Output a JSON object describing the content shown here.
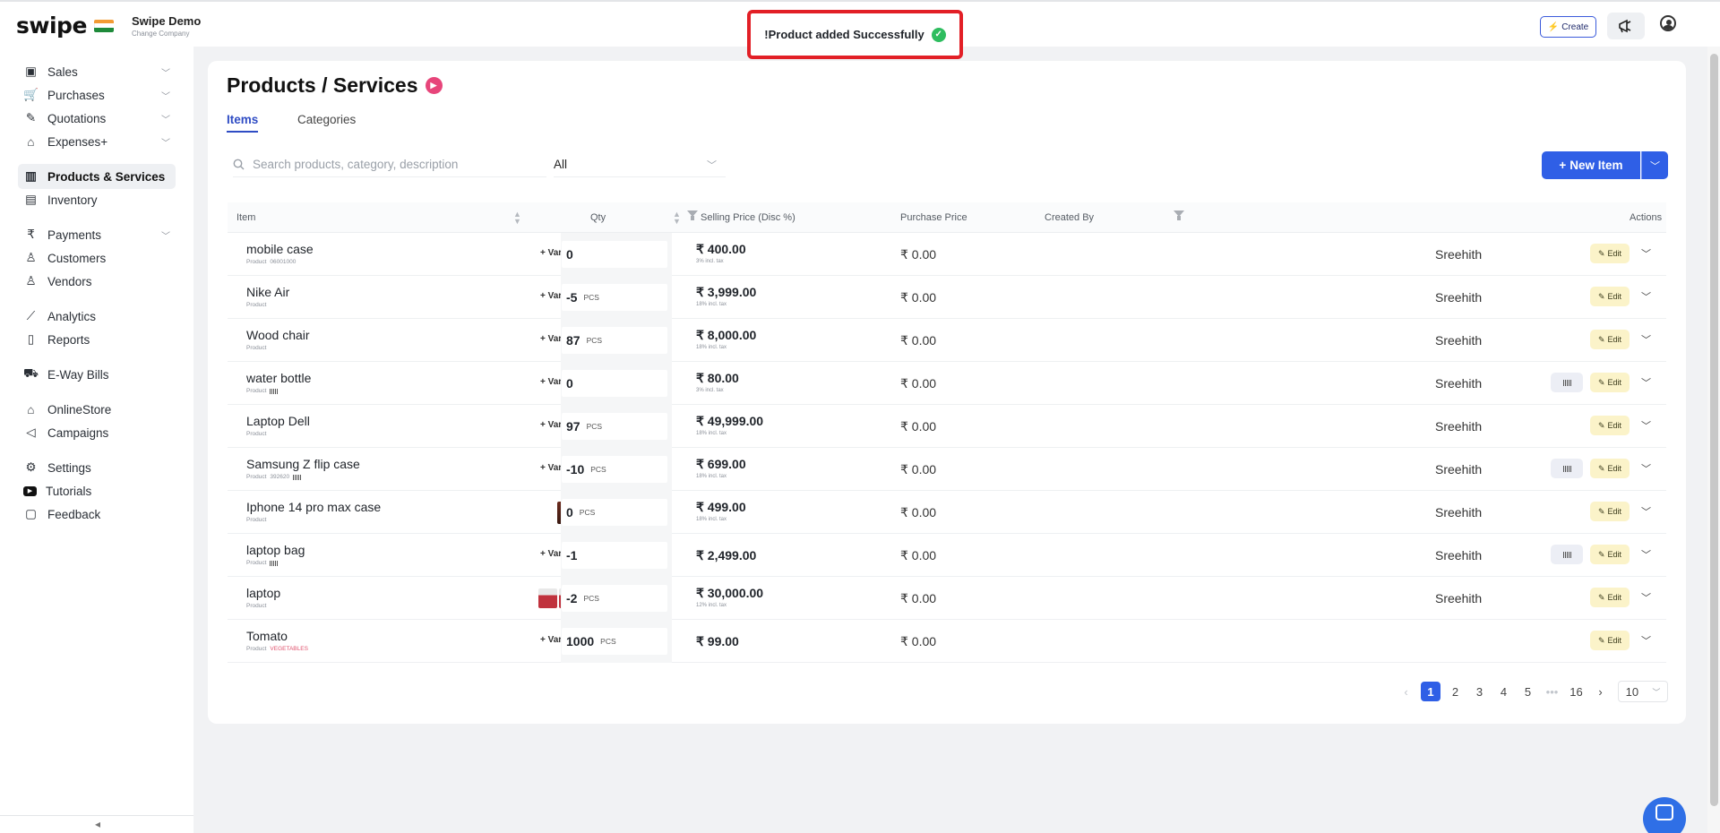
{
  "app": {
    "logo_text": "swipe",
    "company_name": "Swipe Demo",
    "company_sub": "Change Company",
    "create_label": "Create",
    "accent_color": "#2f5fe6"
  },
  "toast": {
    "message": "!Product added Successfully",
    "icon": "check-circle-icon"
  },
  "sidebar": {
    "items": [
      {
        "label": "Sales",
        "icon": "receipt-icon",
        "has_chevron": true
      },
      {
        "label": "Purchases",
        "icon": "cart-icon",
        "has_chevron": true
      },
      {
        "label": "Quotations",
        "icon": "pen-icon",
        "has_chevron": true
      },
      {
        "label": "Expenses+",
        "icon": "tag-icon",
        "has_chevron": true
      },
      {
        "label": "Products & Services",
        "icon": "barcode-icon",
        "has_chevron": false,
        "active": true
      },
      {
        "label": "Inventory",
        "icon": "warehouse-icon",
        "has_chevron": false
      },
      {
        "label": "Payments",
        "icon": "rupee-icon",
        "has_chevron": true
      },
      {
        "label": "Customers",
        "icon": "user-icon",
        "has_chevron": false
      },
      {
        "label": "Vendors",
        "icon": "users-icon",
        "has_chevron": false
      },
      {
        "label": "Analytics",
        "icon": "chart-icon",
        "has_chevron": false
      },
      {
        "label": "Reports",
        "icon": "document-icon",
        "has_chevron": false
      },
      {
        "label": "E-Way Bills",
        "icon": "truck-icon",
        "has_chevron": false
      },
      {
        "label": "OnlineStore",
        "icon": "store-icon",
        "has_chevron": false
      },
      {
        "label": "Campaigns",
        "icon": "megaphone-icon",
        "has_chevron": false
      },
      {
        "label": "Settings",
        "icon": "gear-icon",
        "has_chevron": false
      },
      {
        "label": "Tutorials",
        "icon": "youtube-icon",
        "has_chevron": false
      },
      {
        "label": "Feedback",
        "icon": "chat-icon",
        "has_chevron": false
      }
    ]
  },
  "main": {
    "title": "Products / Services",
    "tabs": [
      {
        "label": "Items",
        "active": true
      },
      {
        "label": "Categories",
        "active": false
      }
    ],
    "search_placeholder": "Search products, category, description",
    "filter_value": "All",
    "new_item_label": "New Item",
    "columns": {
      "item": "Item",
      "qty": "Qty",
      "selling": "Selling Price (Disc %)",
      "purchase": "Purchase Price",
      "created_by": "Created By",
      "actions": "Actions"
    },
    "variants_label": "+ Variants",
    "edit_label": "Edit",
    "rows": [
      {
        "name": "mobile case",
        "sub_type": "Product",
        "sub_code": "06001000",
        "sub_red": false,
        "barcode_sub": false,
        "qty": "0",
        "unit": "",
        "price": "₹ 400.00",
        "tax": "3% incl. tax",
        "purchase": "₹ 0.00",
        "created_by": "Sreehith",
        "barcode_btn": false,
        "thumbs": 0
      },
      {
        "name": "Nike Air",
        "sub_type": "Product",
        "sub_code": "",
        "sub_red": false,
        "barcode_sub": false,
        "qty": "-5",
        "unit": "PCS",
        "price": "₹ 3,999.00",
        "tax": "18% incl. tax",
        "purchase": "₹ 0.00",
        "created_by": "Sreehith",
        "barcode_btn": false,
        "thumbs": 0
      },
      {
        "name": "Wood chair",
        "sub_type": "Product",
        "sub_code": "",
        "sub_red": false,
        "barcode_sub": false,
        "qty": "87",
        "unit": "PCS",
        "price": "₹ 8,000.00",
        "tax": "18% incl. tax",
        "purchase": "₹ 0.00",
        "created_by": "Sreehith",
        "barcode_btn": false,
        "thumbs": 0
      },
      {
        "name": "water bottle",
        "sub_type": "Product",
        "sub_code": "",
        "sub_red": false,
        "barcode_sub": true,
        "qty": "0",
        "unit": "",
        "price": "₹ 80.00",
        "tax": "3% incl. tax",
        "purchase": "₹ 0.00",
        "created_by": "Sreehith",
        "barcode_btn": true,
        "thumbs": 0
      },
      {
        "name": "Laptop Dell",
        "sub_type": "Product",
        "sub_code": "",
        "sub_red": false,
        "barcode_sub": false,
        "qty": "97",
        "unit": "PCS",
        "price": "₹ 49,999.00",
        "tax": "18% incl. tax",
        "purchase": "₹ 0.00",
        "created_by": "Sreehith",
        "barcode_btn": false,
        "thumbs": 0
      },
      {
        "name": "Samsung Z flip case",
        "sub_type": "Product",
        "sub_code": "392620",
        "sub_red": false,
        "barcode_sub": true,
        "qty": "-10",
        "unit": "PCS",
        "price": "₹ 699.00",
        "tax": "18% incl. tax",
        "purchase": "₹ 0.00",
        "created_by": "Sreehith",
        "barcode_btn": true,
        "thumbs": 0
      },
      {
        "name": "Iphone 14 pro max case",
        "sub_type": "Product",
        "sub_code": "",
        "sub_red": false,
        "barcode_sub": false,
        "qty": "0",
        "unit": "PCS",
        "price": "₹ 499.00",
        "tax": "18% incl. tax",
        "purchase": "₹ 0.00",
        "created_by": "Sreehith",
        "barcode_btn": false,
        "thumbs": 1
      },
      {
        "name": "laptop bag",
        "sub_type": "Product",
        "sub_code": "",
        "sub_red": false,
        "barcode_sub": true,
        "qty": "-1",
        "unit": "",
        "price": "₹ 2,499.00",
        "tax": "",
        "purchase": "₹ 0.00",
        "created_by": "Sreehith",
        "barcode_btn": true,
        "thumbs": 0
      },
      {
        "name": "laptop",
        "sub_type": "Product",
        "sub_code": "",
        "sub_red": false,
        "barcode_sub": false,
        "qty": "-2",
        "unit": "PCS",
        "price": "₹ 30,000.00",
        "tax": "12% incl. tax",
        "purchase": "₹ 0.00",
        "created_by": "Sreehith",
        "barcode_btn": false,
        "thumbs": 2
      },
      {
        "name": "Tomato",
        "sub_type": "Product",
        "sub_code": "VEGETABLES",
        "sub_red": true,
        "barcode_sub": false,
        "qty": "1000",
        "unit": "PCS",
        "price": "₹ 99.00",
        "tax": "",
        "purchase": "₹ 0.00",
        "created_by": "",
        "barcode_btn": false,
        "thumbs": 0
      }
    ],
    "pagination": {
      "pages": [
        "1",
        "2",
        "3",
        "4",
        "5",
        "•••",
        "16"
      ],
      "current": "1",
      "page_size": "10"
    }
  }
}
